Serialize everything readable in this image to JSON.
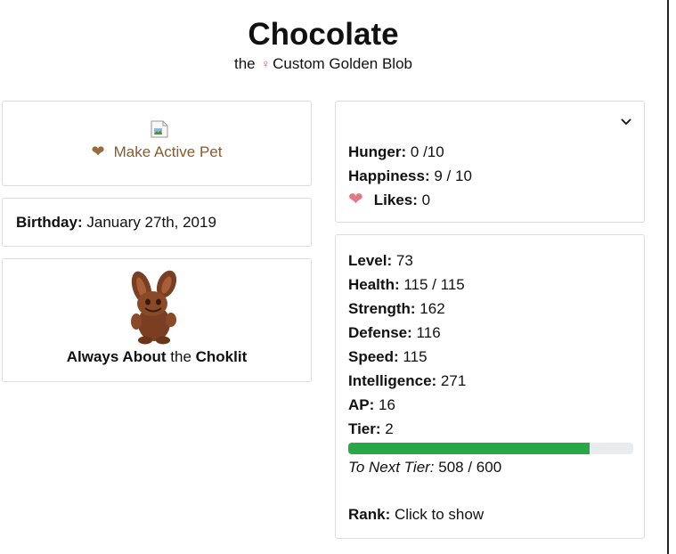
{
  "pet": {
    "name": "Chocolate",
    "subtitle_prefix": "the",
    "gender_icon": "female-icon",
    "species": "Custom Golden Blob"
  },
  "active": {
    "button_label": "Make Active Pet",
    "icon": "heart-icon",
    "image_icon": "broken-image-icon"
  },
  "birthday": {
    "label": "Birthday:",
    "value": "January 27th, 2019"
  },
  "item": {
    "image_icon": "chocolate-bunny-icon",
    "name_bold": "Always About",
    "the": "the",
    "name_bold2": "Choklit"
  },
  "needs": {
    "hunger_label": "Hunger:",
    "hunger_value": "0 /10",
    "happiness_label": "Happiness:",
    "happiness_value": "9 / 10",
    "likes_label": "Likes:",
    "likes_value": "0",
    "likes_icon": "heart-icon",
    "toggle_icon": "chevron-down-icon"
  },
  "stats": {
    "level_label": "Level:",
    "level_value": "73",
    "health_label": "Health:",
    "health_value": "115 / 115",
    "strength_label": "Strength:",
    "strength_value": "162",
    "defense_label": "Defense:",
    "defense_value": "116",
    "speed_label": "Speed:",
    "speed_value": "115",
    "intelligence_label": "Intelligence:",
    "intelligence_value": "271",
    "ap_label": "AP:",
    "ap_value": "16",
    "tier_label": "Tier:",
    "tier_value": "2",
    "tier_progress": 0.8467,
    "next_tier_label": "To Next Tier:",
    "next_tier_value": "508 / 600",
    "rank_label": "Rank:",
    "rank_value": "Click to show"
  },
  "colors": {
    "progress_fill": "#28a745",
    "progress_track": "#e9ecef",
    "make_active_text": "#8a5a2b",
    "heart_brown": "#9a6a3e",
    "heart_pink": "#e07b84",
    "gender_pink": "#d63aa6"
  }
}
